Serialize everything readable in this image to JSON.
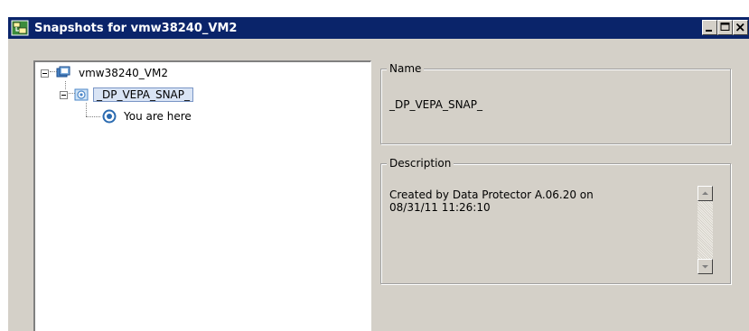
{
  "window": {
    "title": "Snapshots for vmw38240_VM2"
  },
  "tree": {
    "root": {
      "label": "vmw38240_VM2",
      "icon": "vm-icon"
    },
    "snapshot": {
      "label": "_DP_VEPA_SNAP_",
      "icon": "snapshot-icon"
    },
    "current": {
      "label": "You are here",
      "icon": "you-are-here-icon"
    }
  },
  "details": {
    "name_legend": "Name",
    "name_value": "_DP_VEPA_SNAP_",
    "description_legend": "Description",
    "description_value": "Created by Data Protector A.06.20 on\n08/31/11 11:26:10"
  },
  "colors": {
    "titlebar": "#0a246a",
    "window_bg": "#d4d0c8",
    "selection": "#d9e4f5"
  }
}
